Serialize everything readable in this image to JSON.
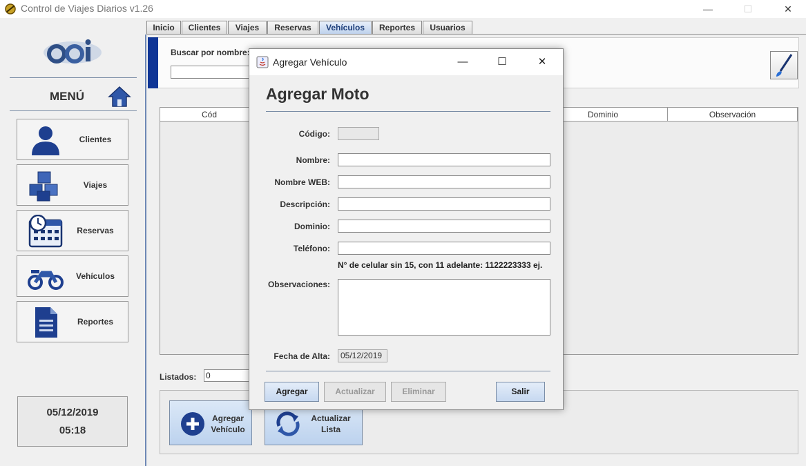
{
  "window": {
    "title": "Control de Viajes Diarios v1.26",
    "controls": [
      "—",
      "☐",
      "✕"
    ]
  },
  "sidebar": {
    "menu_title": "MENÚ",
    "items": [
      {
        "label": "Clientes",
        "icon": "user-icon"
      },
      {
        "label": "Viajes",
        "icon": "boxes-icon"
      },
      {
        "label": "Reservas",
        "icon": "calendar-icon"
      },
      {
        "label": "Vehículos",
        "icon": "motorcycle-icon"
      },
      {
        "label": "Reportes",
        "icon": "document-icon"
      }
    ],
    "date": "05/12/2019",
    "time": "05:18"
  },
  "tabs": [
    {
      "label": "Inicio"
    },
    {
      "label": "Clientes"
    },
    {
      "label": "Viajes"
    },
    {
      "label": "Reservas"
    },
    {
      "label": "Vehículos",
      "active": true
    },
    {
      "label": "Reportes"
    },
    {
      "label": "Usuarios"
    }
  ],
  "search": {
    "label": "Buscar por nombre:",
    "value": ""
  },
  "table": {
    "columns": [
      "Cód",
      "Dominio",
      "Observación"
    ]
  },
  "listados": {
    "label": "Listados:",
    "value": "0"
  },
  "actions": {
    "add_line1": "Agregar",
    "add_line2": "Vehículo",
    "refresh_line1": "Actualizar",
    "refresh_line2": "Lista"
  },
  "dialog": {
    "title": "Agregar Vehículo",
    "heading": "Agregar Moto",
    "fields": {
      "codigo": {
        "label": "Código:",
        "value": ""
      },
      "nombre": {
        "label": "Nombre:",
        "value": ""
      },
      "nombre_web": {
        "label": "Nombre WEB:",
        "value": ""
      },
      "descripcion": {
        "label": "Descripción:",
        "value": ""
      },
      "dominio": {
        "label": "Dominio:",
        "value": ""
      },
      "telefono": {
        "label": "Teléfono:",
        "value": ""
      },
      "observaciones": {
        "label": "Observaciones:",
        "value": ""
      },
      "fecha_alta": {
        "label": "Fecha de Alta:",
        "value": "05/12/2019"
      }
    },
    "hint": "N° de celular sin 15, con 11 adelante: 1122223333 ej.",
    "buttons": {
      "agregar": "Agregar",
      "actualizar": "Actualizar",
      "eliminar": "Eliminar",
      "salir": "Salir"
    }
  },
  "colors": {
    "accent": "#0f3596",
    "icon_blue": "#1a3f8f",
    "button_blue": "#c6d8f0"
  }
}
